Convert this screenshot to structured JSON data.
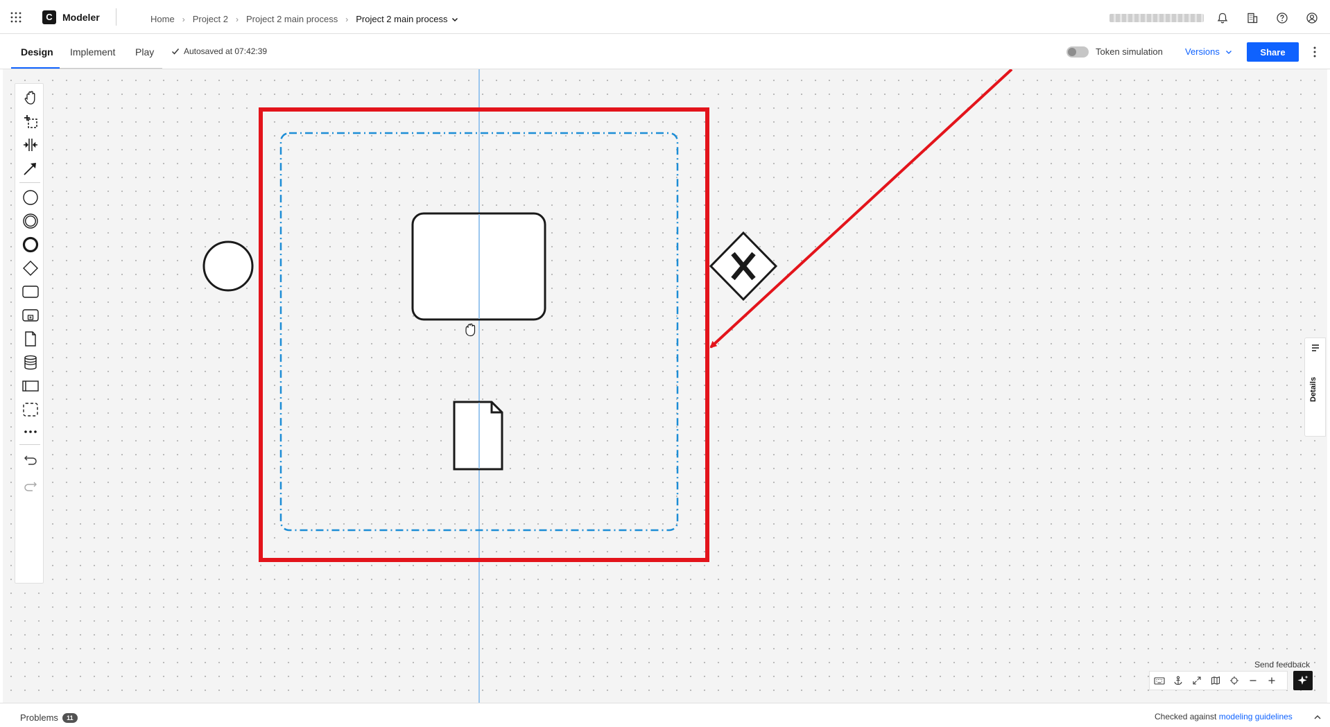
{
  "app": {
    "name": "Modeler",
    "logo_letter": "C"
  },
  "breadcrumb": {
    "items": [
      "Home",
      "Project 2",
      "Project 2 main process"
    ],
    "current": "Project 2 main process",
    "separator": "›"
  },
  "header_icons": [
    "notification-icon",
    "organization-icon",
    "help-icon",
    "user-icon"
  ],
  "tabs": [
    {
      "label": "Design",
      "active": true
    },
    {
      "label": "Implement",
      "active": false
    },
    {
      "label": "Play",
      "active": false
    }
  ],
  "autosave": {
    "text": "Autosaved at 07:42:39"
  },
  "token_simulation": {
    "label": "Token simulation",
    "enabled": false
  },
  "versions": {
    "label": "Versions"
  },
  "share": {
    "label": "Share"
  },
  "palette": {
    "tools": [
      "hand-tool",
      "lasso-tool",
      "space-tool",
      "connect-tool"
    ],
    "elements": [
      "start-event",
      "intermediate-event",
      "end-event",
      "gateway",
      "task",
      "subprocess",
      "data-object",
      "data-store",
      "pool",
      "group",
      "more"
    ],
    "history": [
      "undo",
      "redo"
    ]
  },
  "diagram": {
    "start_event": "circle",
    "task": "rounded-rectangle",
    "gateway": {
      "type": "exclusive",
      "marker": "X"
    },
    "data_object": "document",
    "group": "dash-dot-rectangle",
    "annotation": {
      "highlight_color": "#e3141b",
      "arrow_color": "#e3141b"
    },
    "group_color": "#1c8dd6",
    "guide_line_color": "#9ac6ee"
  },
  "details": {
    "label": "Details"
  },
  "feedback": {
    "label": "Send feedback"
  },
  "canvas_controls": [
    "keyboard-icon",
    "anchor-icon",
    "fullscreen-icon",
    "minimap-icon",
    "center-icon",
    "zoom-out-icon",
    "zoom-in-icon"
  ],
  "footer": {
    "problems_label": "Problems",
    "problems_count": "11",
    "checked_prefix": "Checked against ",
    "checked_link": "modeling guidelines"
  },
  "colors": {
    "accent": "#0f62fe",
    "canvas": "#f4f4f4",
    "text": "#161616"
  }
}
